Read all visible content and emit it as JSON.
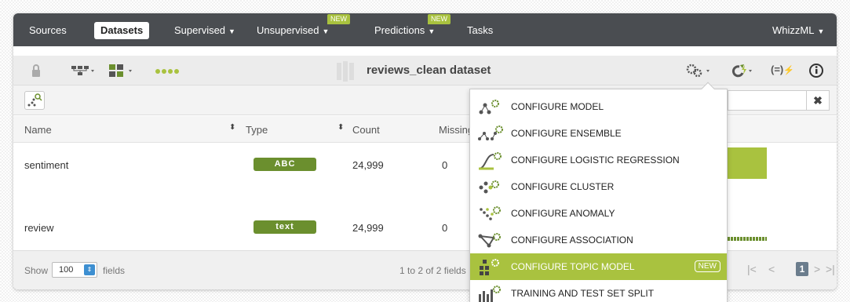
{
  "nav": {
    "items": [
      {
        "label": "Sources",
        "caret": false
      },
      {
        "label": "Datasets",
        "caret": false,
        "active": true
      },
      {
        "label": "Supervised",
        "caret": true
      },
      {
        "label": "Unsupervised",
        "caret": true,
        "badge": "NEW"
      },
      {
        "label": "Predictions",
        "caret": true,
        "badge": "NEW"
      },
      {
        "label": "Tasks",
        "caret": false
      }
    ],
    "right_label": "WhizzML",
    "caret_glyph": "▼"
  },
  "toolbar": {
    "dataset_title": "reviews_clean dataset",
    "icons": [
      "lock-icon",
      "tree-icon",
      "fields-icon",
      "dots-icon",
      "gears-icon",
      "refresh-icon",
      "formula-icon",
      "info-icon"
    ],
    "formula_text": "(=)"
  },
  "subbar": {
    "clear_label": "✖"
  },
  "table": {
    "columns": [
      "Name",
      "Type",
      "Count",
      "Missing"
    ],
    "rows": [
      {
        "name": "sentiment",
        "type": "ABC",
        "count": "24,999",
        "missing": "0"
      },
      {
        "name": "review",
        "type": "text",
        "count": "24,999",
        "missing": "0"
      }
    ]
  },
  "footer": {
    "show_label": "Show",
    "show_value": "100",
    "fields_label": "fields",
    "pagination_text": "1 to 2 of 2 fields",
    "current_page": "1"
  },
  "menu": {
    "items": [
      {
        "label": "CONFIGURE MODEL",
        "icon": "model-icon"
      },
      {
        "label": "CONFIGURE ENSEMBLE",
        "icon": "ensemble-icon"
      },
      {
        "label": "CONFIGURE LOGISTIC REGRESSION",
        "icon": "logistic-icon"
      },
      {
        "label": "CONFIGURE CLUSTER",
        "icon": "cluster-icon"
      },
      {
        "label": "CONFIGURE ANOMALY",
        "icon": "anomaly-icon"
      },
      {
        "label": "CONFIGURE ASSOCIATION",
        "icon": "association-icon"
      },
      {
        "label": "CONFIGURE TOPIC MODEL",
        "icon": "topic-model-icon",
        "highlighted": true,
        "badge": "NEW"
      },
      {
        "label": "TRAINING AND TEST SET SPLIT",
        "icon": "split-icon"
      }
    ]
  },
  "colors": {
    "nav_bg": "#4a4d51",
    "accent_green": "#a9c23f",
    "badge_dark_green": "#6b8f2e",
    "page_blue": "#3d8fd1"
  }
}
